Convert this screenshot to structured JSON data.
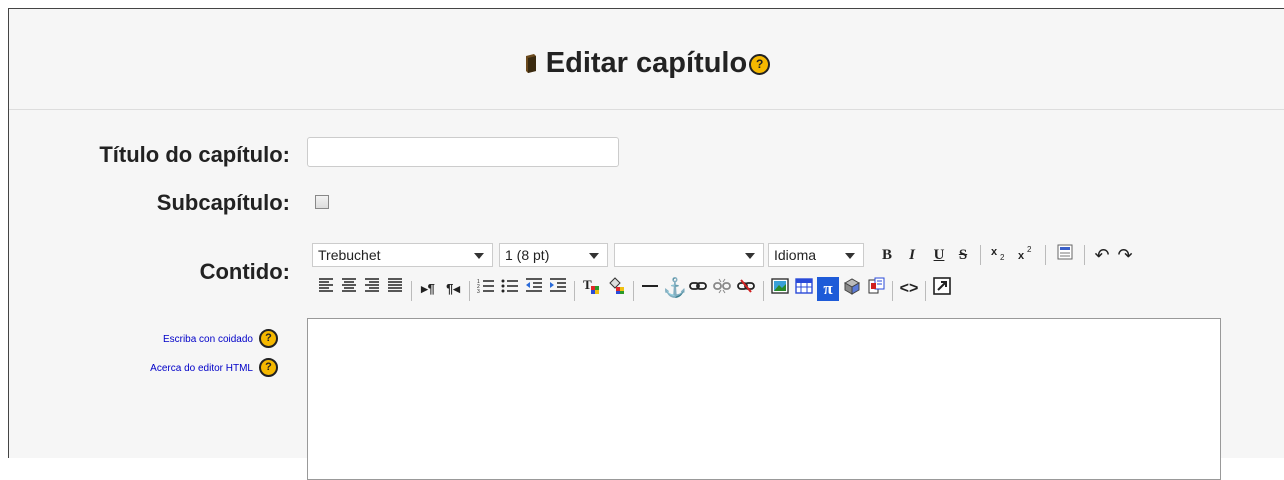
{
  "page": {
    "title": "Editar capítulo"
  },
  "form": {
    "chapter_title_label": "Título do capítulo:",
    "chapter_title_value": "",
    "subchapter_label": "Subcapítulo:",
    "subchapter_checked": false,
    "content_label": "Contido:"
  },
  "help_links": {
    "write_carefully": "Escriba con coidado",
    "about_html_editor": "Acerca do editor HTML"
  },
  "toolbar": {
    "font_family": "Trebuchet",
    "font_size": "1 (8 pt)",
    "format": "",
    "language": "Idioma",
    "bold": "B",
    "italic": "I",
    "underline": "U",
    "strike": "S"
  },
  "colors": {
    "help_icon": "#f5b800",
    "link": "#0000c8",
    "accent_blue": "#1e5bd8"
  }
}
